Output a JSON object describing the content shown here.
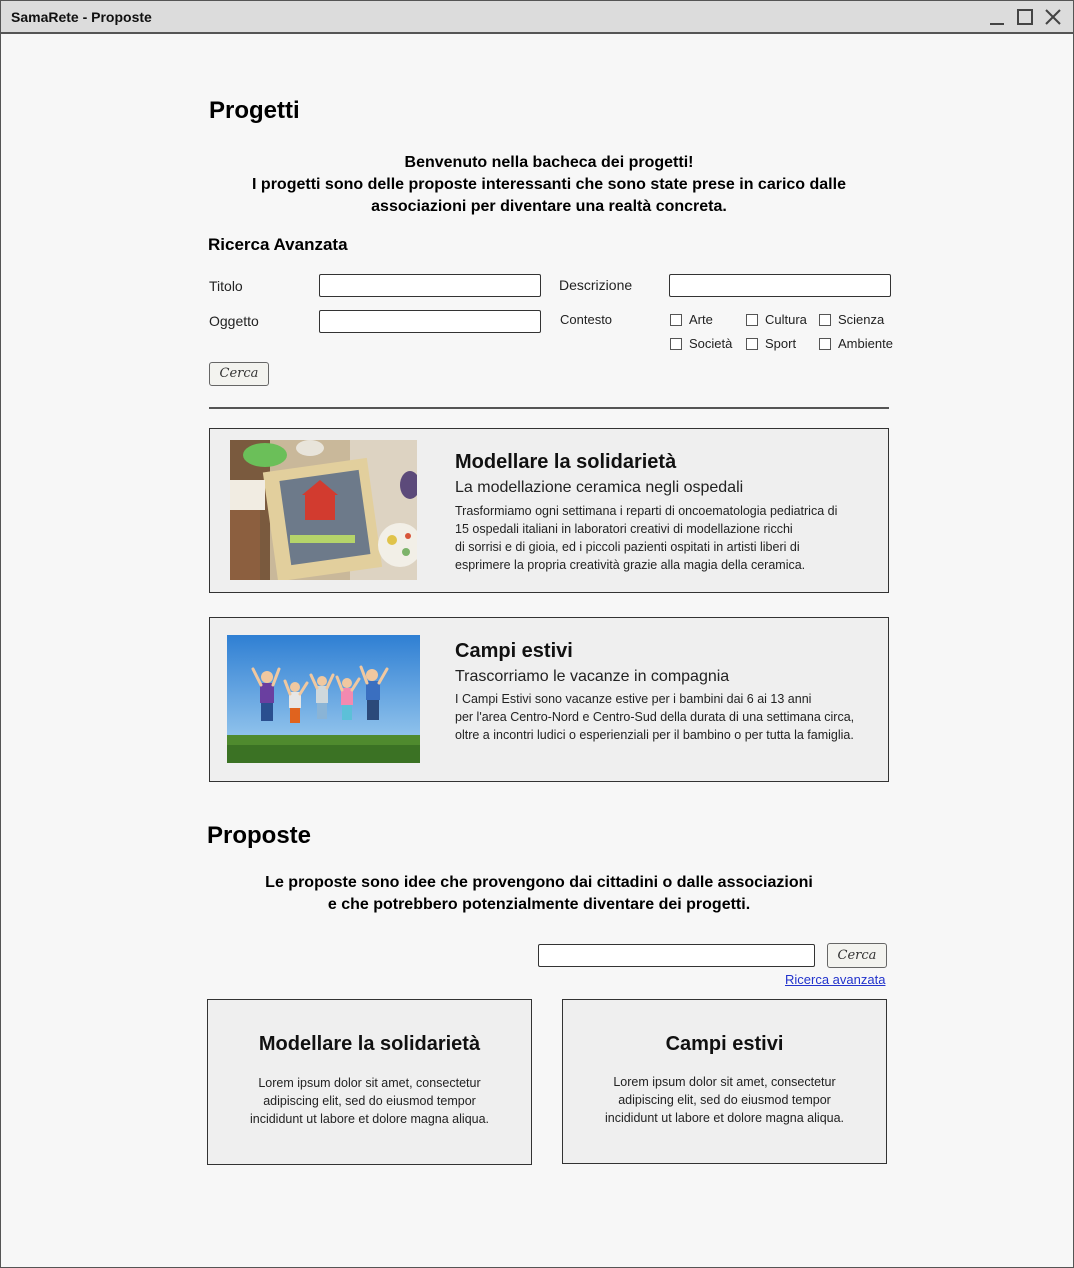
{
  "window": {
    "title": "SamaRete - Proposte"
  },
  "progetti": {
    "heading": "Progetti",
    "intro_lines": [
      "Benvenuto nella bacheca dei progetti!",
      "I progetti sono delle proposte interessanti che sono state prese in carico dalle",
      "associazioni per diventare una realtà concreta."
    ],
    "advanced_search": {
      "heading": "Ricerca Avanzata",
      "titolo_label": "Titolo",
      "titolo_value": "",
      "descrizione_label": "Descrizione",
      "descrizione_value": "",
      "oggetto_label": "Oggetto",
      "oggetto_value": "",
      "contesto_label": "Contesto",
      "contexts": [
        "Arte",
        "Cultura",
        "Scienza",
        "Società",
        "Sport",
        "Ambiente"
      ],
      "search_button": "Cerca"
    },
    "cards": [
      {
        "title": "Modellare la solidarietà",
        "subtitle": "La modellazione ceramica negli ospedali",
        "desc_lines": [
          "Trasformiamo ogni settimana i reparti di oncoematologia pediatrica di",
          "15 ospedali italiani in laboratori creativi di modellazione ricchi",
          "di sorrisi e di gioia, ed i piccoli pazienti ospitati in artisti liberi di",
          "esprimere la propria creatività grazie alla magia della ceramica."
        ]
      },
      {
        "title": "Campi estivi",
        "subtitle": "Trascorriamo le vacanze in compagnia",
        "desc_lines": [
          "I Campi Estivi sono vacanze estive per i bambini dai 6 ai 13 anni",
          "per l'area Centro-Nord e Centro-Sud della durata di una settimana circa,",
          "oltre a incontri ludici o esperienziali per il bambino o per tutta la famiglia."
        ]
      }
    ]
  },
  "proposte": {
    "heading": "Proposte",
    "intro_lines": [
      "Le proposte sono idee che provengono dai cittadini o dalle associazioni",
      "e che potrebbero potenzialmente diventare dei progetti."
    ],
    "search_value": "",
    "search_button": "Cerca",
    "advanced_link": "Ricerca avanzata",
    "cards": [
      {
        "title": "Modellare la solidarietà",
        "desc_lines": [
          "Lorem ipsum dolor sit amet, consectetur",
          "adipiscing elit, sed do eiusmod tempor",
          "incididunt ut labore et dolore magna aliqua."
        ]
      },
      {
        "title": "Campi estivi",
        "desc_lines": [
          "Lorem ipsum dolor sit amet, consectetur",
          "adipiscing elit, sed do eiusmod tempor",
          "incididunt ut labore et dolore magna aliqua."
        ]
      }
    ]
  },
  "icons": {
    "minimize": "minimize-icon",
    "maximize": "maximize-icon",
    "close": "close-icon",
    "checkbox": "checkbox-icon"
  }
}
